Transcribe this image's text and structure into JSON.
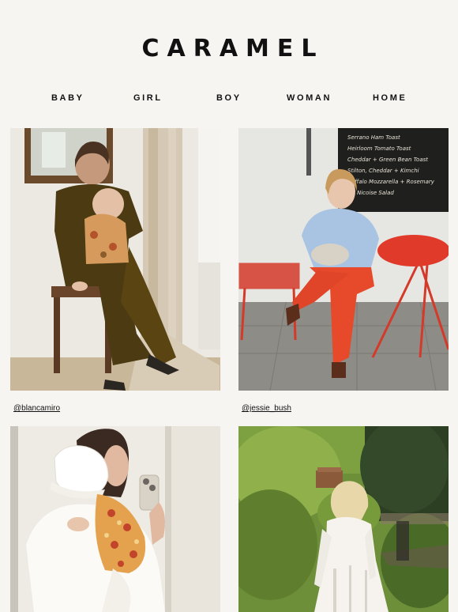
{
  "brand": {
    "name": "CARAMEL"
  },
  "nav": {
    "items": [
      {
        "label": "BABY"
      },
      {
        "label": "GIRL"
      },
      {
        "label": "BOY"
      },
      {
        "label": "WOMAN"
      },
      {
        "label": "HOME"
      }
    ]
  },
  "gallery": {
    "items": [
      {
        "caption": "@blancamiro",
        "image": "woman-seated-holding-baby-photo"
      },
      {
        "caption": "@jessie_bush",
        "image": "woman-seated-red-chair-cafe-photo"
      },
      {
        "caption": "",
        "image": "mirror-selfie-with-baby-photo"
      },
      {
        "caption": "",
        "image": "girl-white-dress-garden-photo"
      }
    ]
  },
  "chalkboard": {
    "lines": [
      "Serrano Ham Toast",
      "Heirloom Tomato Toast",
      "Cheddar + Green Bean Toast",
      "Stilton, Cheddar + Kimchi",
      "Buffalo Mozzarella + Rosemary",
      "Nicoise Salad"
    ]
  }
}
